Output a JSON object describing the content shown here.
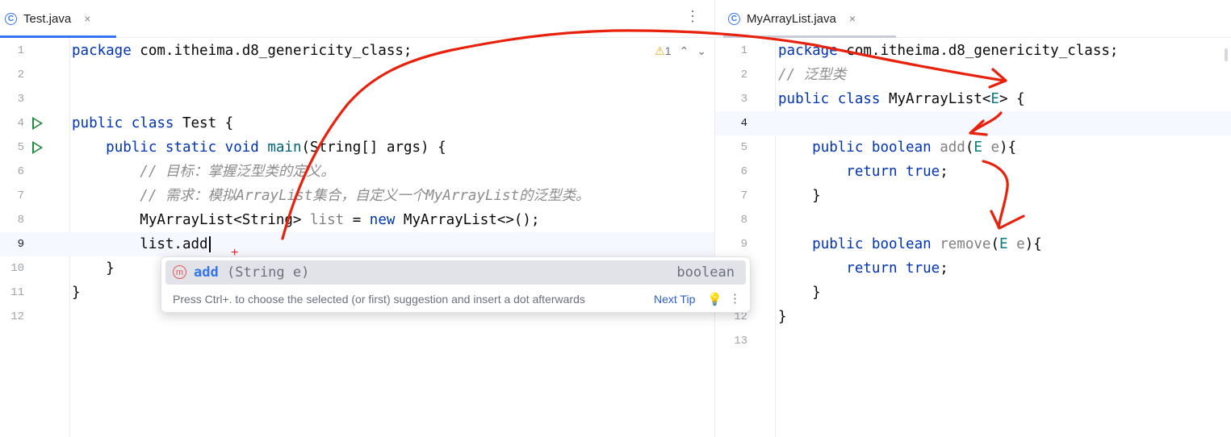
{
  "left_editor": {
    "tab": {
      "icon": "class-icon",
      "icon_glyph": "C",
      "title": "Test.java",
      "close": "×"
    },
    "tab_menu": "⋮",
    "inspection": {
      "warning_icon": "warning-icon",
      "warning_glyph": "⚠",
      "count": "1",
      "up": "⌃",
      "down": "⌄"
    },
    "lines": [
      {
        "n": "1",
        "run": false,
        "html": "<span class='kw'>package</span> com.itheima.d8_genericity_class;"
      },
      {
        "n": "2",
        "run": false,
        "html": ""
      },
      {
        "n": "3",
        "run": false,
        "html": ""
      },
      {
        "n": "4",
        "run": true,
        "html": "<span class='kw'>public class</span> Test {"
      },
      {
        "n": "5",
        "run": true,
        "html": "    <span class='kw'>public static void</span> <span class='mt'>main</span>(String[] args) {"
      },
      {
        "n": "6",
        "run": false,
        "html": "        <span class='cm'>// 目标：掌握泛型类的定义。</span>"
      },
      {
        "n": "7",
        "run": false,
        "html": "        <span class='cm'>// 需求：模拟ArrayList集合，自定义一个MyArrayList的泛型类。</span>"
      },
      {
        "n": "8",
        "run": false,
        "html": "        MyArrayList&lt;String&gt; <span class='gr'>list</span> = <span class='kw'>new</span> MyArrayList&lt;&gt;();"
      },
      {
        "n": "9",
        "run": false,
        "current": true,
        "html": "        list.add<span class='caret'></span>"
      },
      {
        "n": "10",
        "run": false,
        "html": "    }"
      },
      {
        "n": "11",
        "run": false,
        "html": "}"
      },
      {
        "n": "12",
        "run": false,
        "html": ""
      }
    ]
  },
  "completion_popup": {
    "item_icon": "method-icon",
    "item_icon_glyph": "m",
    "item_name": "add",
    "item_signature": "(String e)",
    "item_return": "boolean",
    "hint": "Press Ctrl+. to choose the selected (or first) suggestion and insert a dot afterwards",
    "next_tip": "Next Tip",
    "bulb_icon": "bulb-icon",
    "bulb_glyph": "💡",
    "menu": "⋮"
  },
  "right_editor": {
    "tab": {
      "icon": "class-icon",
      "icon_glyph": "C",
      "title": "MyArrayList.java",
      "close": "×"
    },
    "lines": [
      {
        "n": "1",
        "html": "<span class='kw'>package</span> com.itheima.d8_genericity_class;"
      },
      {
        "n": "2",
        "html": "<span class='cm'>// 泛型类</span>"
      },
      {
        "n": "3",
        "html": "<span class='kw'>public class</span> MyArrayList&lt;<span class='ty'>E</span>&gt; {"
      },
      {
        "n": "4",
        "current": true,
        "html": ""
      },
      {
        "n": "5",
        "html": "    <span class='kw'>public boolean</span> <span class='gr'>add</span>(<span class='ty'>E</span> <span class='gr'>e</span>){"
      },
      {
        "n": "6",
        "html": "        <span class='kw'>return true</span>;"
      },
      {
        "n": "7",
        "html": "    }"
      },
      {
        "n": "8",
        "html": ""
      },
      {
        "n": "9",
        "html": "    <span class='kw'>public boolean</span> <span class='gr'>remove</span>(<span class='ty'>E</span> <span class='gr'>e</span>){"
      },
      {
        "n": "10",
        "html": "        <span class='kw'>return true</span>;"
      },
      {
        "n": "11",
        "html": "    }"
      },
      {
        "n": "12",
        "html": "}"
      },
      {
        "n": "13",
        "html": ""
      }
    ]
  },
  "colors": {
    "accent": "#3574f0",
    "keyword": "#0033b3",
    "comment": "#8c8c8c",
    "annotation": "#e8210c"
  }
}
